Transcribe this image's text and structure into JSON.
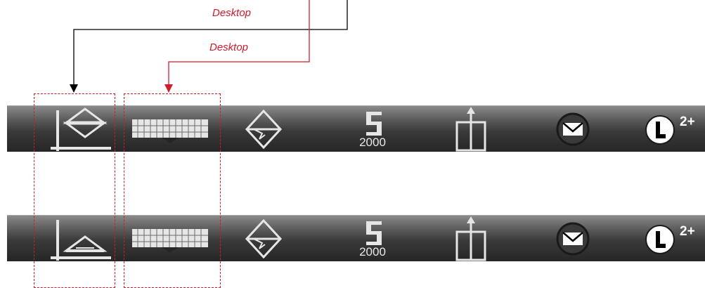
{
  "callouts": [
    {
      "label": "Desktop",
      "color": "#d11a2a"
    },
    {
      "label": "Desktop",
      "color": "#d11a2a"
    }
  ],
  "toolbars": [
    {
      "variant": "top",
      "items": [
        {
          "icon": "axis-triangle-up-icon"
        },
        {
          "icon": "keyboard-icon"
        },
        {
          "icon": "diamond-tool-icon"
        },
        {
          "icon": "s-numeral-icon",
          "value": "2000"
        },
        {
          "icon": "export-box-icon"
        },
        {
          "icon": "mail-icon"
        },
        {
          "icon": "level-l-icon",
          "badge": "2+"
        }
      ]
    },
    {
      "variant": "bottom",
      "items": [
        {
          "icon": "axis-triangle-down-icon"
        },
        {
          "icon": "keyboard-icon"
        },
        {
          "icon": "diamond-tool-icon"
        },
        {
          "icon": "s-numeral-icon",
          "value": "2000"
        },
        {
          "icon": "export-box-icon"
        },
        {
          "icon": "mail-icon"
        },
        {
          "icon": "level-l-icon",
          "badge": "2+"
        }
      ]
    }
  ],
  "colors": {
    "callout_red": "#d11a2a",
    "callout_black": "#000000",
    "icon": "#e6e6e6"
  }
}
